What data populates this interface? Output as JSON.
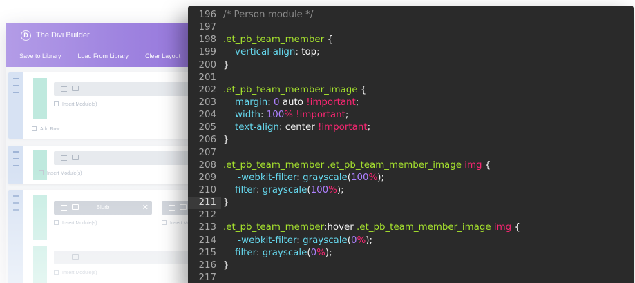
{
  "builder": {
    "logo_letter": "D",
    "title": "The Divi Builder",
    "actions": [
      "Save to Library",
      "Load From Library",
      "Clear Layout"
    ],
    "insert_module_label": "Insert Module(s)",
    "add_row_label": "Add Row",
    "blurb_label": "Blurb",
    "close_glyph": "✕",
    "colors": {
      "header_start": "#b39ce7",
      "header_end": "#9474da",
      "section_handle": "#d7e2f3",
      "row_handle": "#bfe9de"
    }
  },
  "editor": {
    "colors": {
      "background": "#2a2a2a",
      "gutter": "#a8a8a8",
      "comment": "#8b8b8b",
      "selector": "#a6e22e",
      "property": "#66d9ef",
      "number": "#ae81ff",
      "important": "#f92672"
    },
    "active_line": 211,
    "lines": [
      {
        "n": "196",
        "tokens": [
          {
            "t": "comment",
            "v": "/* Person module */"
          }
        ]
      },
      {
        "n": "197",
        "tokens": []
      },
      {
        "n": "198",
        "tokens": [
          {
            "t": "selector",
            "v": ".et_pb_team_member"
          },
          {
            "t": "plain",
            "v": " {"
          }
        ]
      },
      {
        "n": "199",
        "tokens": [
          {
            "t": "plain",
            "v": "    "
          },
          {
            "t": "prop",
            "v": "vertical-align"
          },
          {
            "t": "plain",
            "v": ": top;"
          }
        ]
      },
      {
        "n": "200",
        "tokens": [
          {
            "t": "plain",
            "v": "}"
          }
        ]
      },
      {
        "n": "201",
        "tokens": []
      },
      {
        "n": "202",
        "tokens": [
          {
            "t": "selector",
            "v": ".et_pb_team_member_image"
          },
          {
            "t": "plain",
            "v": " {"
          }
        ]
      },
      {
        "n": "203",
        "tokens": [
          {
            "t": "plain",
            "v": "    "
          },
          {
            "t": "prop",
            "v": "margin"
          },
          {
            "t": "plain",
            "v": ": "
          },
          {
            "t": "num",
            "v": "0"
          },
          {
            "t": "plain",
            "v": " auto "
          },
          {
            "t": "imp",
            "v": "!important"
          },
          {
            "t": "plain",
            "v": ";"
          }
        ]
      },
      {
        "n": "204",
        "tokens": [
          {
            "t": "plain",
            "v": "    "
          },
          {
            "t": "prop",
            "v": "width"
          },
          {
            "t": "plain",
            "v": ": "
          },
          {
            "t": "num",
            "v": "100"
          },
          {
            "t": "imp",
            "v": "%"
          },
          {
            "t": "plain",
            "v": " "
          },
          {
            "t": "imp",
            "v": "!important"
          },
          {
            "t": "plain",
            "v": ";"
          }
        ]
      },
      {
        "n": "205",
        "tokens": [
          {
            "t": "plain",
            "v": "    "
          },
          {
            "t": "prop",
            "v": "text-align"
          },
          {
            "t": "plain",
            "v": ": center "
          },
          {
            "t": "imp",
            "v": "!important"
          },
          {
            "t": "plain",
            "v": ";"
          }
        ]
      },
      {
        "n": "206",
        "tokens": [
          {
            "t": "plain",
            "v": "}"
          }
        ]
      },
      {
        "n": "207",
        "tokens": []
      },
      {
        "n": "208",
        "tokens": [
          {
            "t": "selector",
            "v": ".et_pb_team_member .et_pb_team_member_image"
          },
          {
            "t": "plain",
            "v": " "
          },
          {
            "t": "kw",
            "v": "img"
          },
          {
            "t": "plain",
            "v": " {"
          }
        ]
      },
      {
        "n": "209",
        "tokens": [
          {
            "t": "plain",
            "v": "     "
          },
          {
            "t": "prop",
            "v": "-webkit-filter"
          },
          {
            "t": "plain",
            "v": ": "
          },
          {
            "t": "prop",
            "v": "grayscale"
          },
          {
            "t": "plain",
            "v": "("
          },
          {
            "t": "num",
            "v": "100"
          },
          {
            "t": "imp",
            "v": "%"
          },
          {
            "t": "plain",
            "v": ");"
          }
        ]
      },
      {
        "n": "210",
        "tokens": [
          {
            "t": "plain",
            "v": "    "
          },
          {
            "t": "prop",
            "v": "filter"
          },
          {
            "t": "plain",
            "v": ": "
          },
          {
            "t": "prop",
            "v": "grayscale"
          },
          {
            "t": "plain",
            "v": "("
          },
          {
            "t": "num",
            "v": "100"
          },
          {
            "t": "imp",
            "v": "%"
          },
          {
            "t": "plain",
            "v": ");"
          }
        ]
      },
      {
        "n": "211",
        "tokens": [
          {
            "t": "plain",
            "v": "}"
          }
        ]
      },
      {
        "n": "212",
        "tokens": []
      },
      {
        "n": "213",
        "tokens": [
          {
            "t": "selector",
            "v": ".et_pb_team_member"
          },
          {
            "t": "plain",
            "v": ":hover "
          },
          {
            "t": "selector",
            "v": ".et_pb_team_member_image"
          },
          {
            "t": "plain",
            "v": " "
          },
          {
            "t": "kw",
            "v": "img"
          },
          {
            "t": "plain",
            "v": " {"
          }
        ]
      },
      {
        "n": "214",
        "tokens": [
          {
            "t": "plain",
            "v": "     "
          },
          {
            "t": "prop",
            "v": "-webkit-filter"
          },
          {
            "t": "plain",
            "v": ": "
          },
          {
            "t": "prop",
            "v": "grayscale"
          },
          {
            "t": "plain",
            "v": "("
          },
          {
            "t": "num",
            "v": "0"
          },
          {
            "t": "imp",
            "v": "%"
          },
          {
            "t": "plain",
            "v": ");"
          }
        ]
      },
      {
        "n": "215",
        "tokens": [
          {
            "t": "plain",
            "v": "    "
          },
          {
            "t": "prop",
            "v": "filter"
          },
          {
            "t": "plain",
            "v": ": "
          },
          {
            "t": "prop",
            "v": "grayscale"
          },
          {
            "t": "plain",
            "v": "("
          },
          {
            "t": "num",
            "v": "0"
          },
          {
            "t": "imp",
            "v": "%"
          },
          {
            "t": "plain",
            "v": ");"
          }
        ]
      },
      {
        "n": "216",
        "tokens": [
          {
            "t": "plain",
            "v": "}"
          }
        ]
      },
      {
        "n": "217",
        "tokens": []
      }
    ]
  }
}
